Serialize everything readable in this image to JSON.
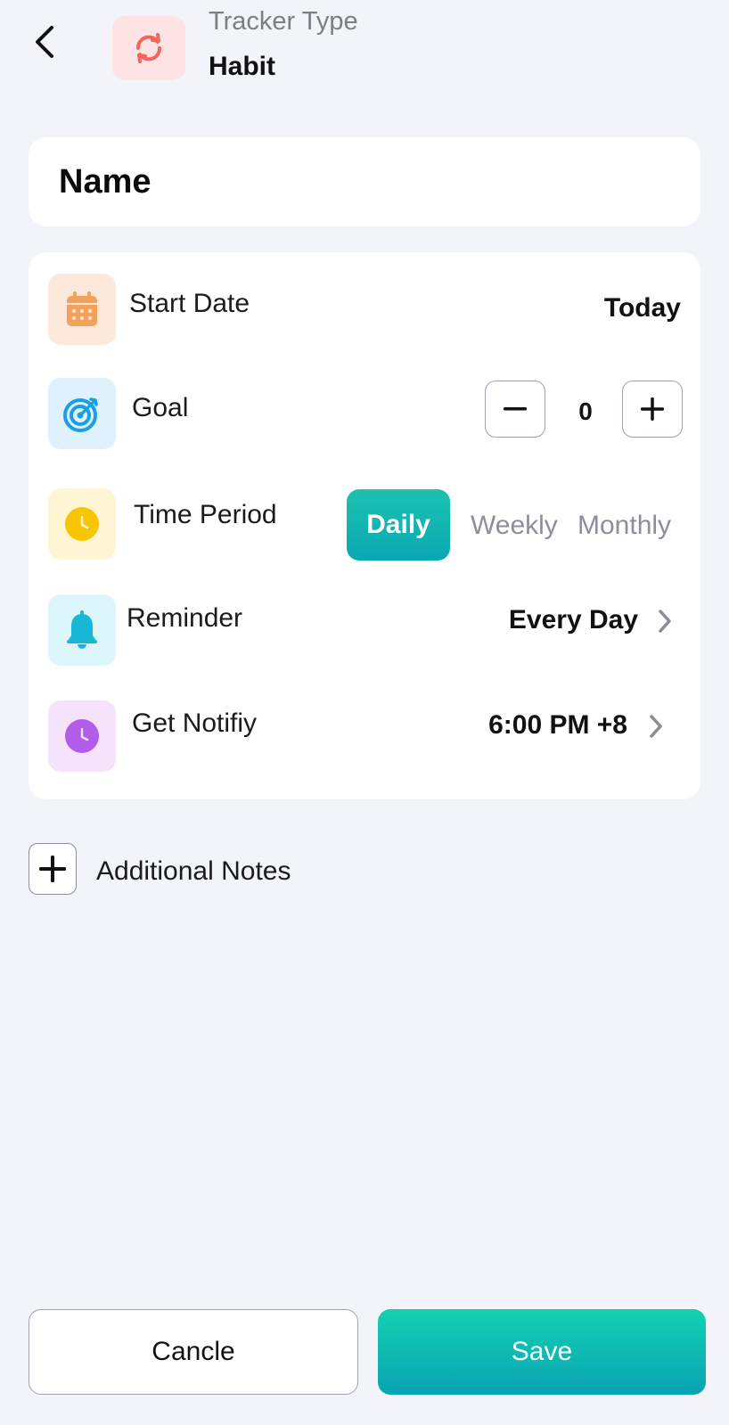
{
  "header": {
    "back_icon": "chevron-left-icon",
    "type_icon": "repeat-icon",
    "type_caption": "Tracker Type",
    "type_value": "Habit"
  },
  "name": {
    "placeholder": "Name",
    "value": ""
  },
  "settings": {
    "start_date": {
      "label": "Start Date",
      "value": "Today",
      "icon": "calendar-icon"
    },
    "goal": {
      "label": "Goal",
      "value": "0",
      "icon": "target-icon"
    },
    "time_period": {
      "label": "Time Period",
      "icon": "clock-icon",
      "options": [
        "Daily",
        "Weekly",
        "Monthly"
      ],
      "selected": "Daily"
    },
    "reminder": {
      "label": "Reminder",
      "value": "Every Day",
      "icon": "bell-icon"
    },
    "notify": {
      "label": "Get Notifiy",
      "value": "6:00 PM +8",
      "icon": "clock-icon"
    }
  },
  "notes": {
    "label": "Additional Notes"
  },
  "actions": {
    "cancel": "Cancle",
    "save": "Save"
  },
  "colors": {
    "accent_teal": "#12c3b2",
    "habit_red": "#f0675e",
    "calendar_orange": "#f6a15a",
    "target_blue": "#1a9ee6",
    "clock_yellow": "#f7c600",
    "bell_cyan": "#16b8d6",
    "notify_purple": "#b35ce8"
  }
}
